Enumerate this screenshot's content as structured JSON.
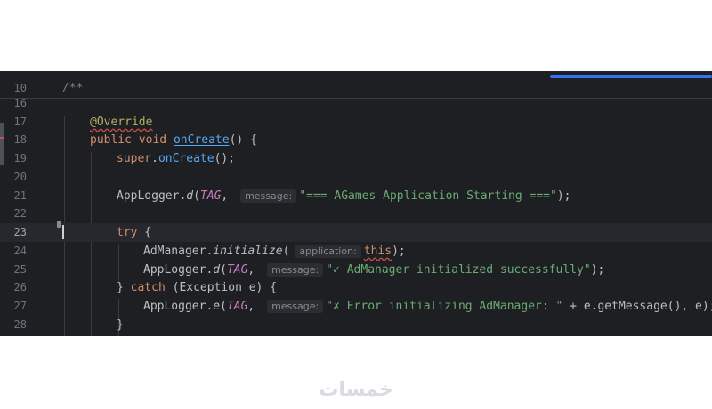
{
  "colors": {
    "editor_background": "#1e1f22",
    "current_line": "#26282e",
    "keyword": "#cf8e6d",
    "annotation": "#b3ae60",
    "method": "#56a8f5",
    "string": "#6aab73",
    "constant": "#c77dbb",
    "comment": "#7a7e85",
    "progress": "#3574f0",
    "error_underline": "#c94f4f"
  },
  "progress": {
    "fraction": 1.0
  },
  "editor": {
    "current_line": "23",
    "lines": [
      {
        "num": "10",
        "comment": "/**"
      },
      {
        "num": "16"
      },
      {
        "num": "17",
        "annotation": "@Override"
      },
      {
        "num": "18",
        "kw1": "public",
        "kw2": "void",
        "method": "onCreate",
        "rest": "() {"
      },
      {
        "num": "19",
        "kw": "super",
        "dot": ".",
        "method": "onCreate",
        "rest": "();"
      },
      {
        "num": "20"
      },
      {
        "num": "21",
        "cls": "AppLogger.",
        "method": "d",
        "open": "(",
        "const": "TAG",
        "comma": ", ",
        "hint": "message:",
        "str": "\"=== AGames Application Starting ===\"",
        "rest": ");"
      },
      {
        "num": "22"
      },
      {
        "num": "23",
        "kw": "try",
        "rest": " {"
      },
      {
        "num": "24",
        "cls": "AdManager.",
        "method": "initialize",
        "open": "(",
        "hint": "application:",
        "kw": "this",
        "rest": ");"
      },
      {
        "num": "25",
        "cls": "AppLogger.",
        "method": "d",
        "open": "(",
        "const": "TAG",
        "comma": ", ",
        "hint": "message:",
        "str": "\"✓ AdManager initialized successfully\"",
        "rest": ");"
      },
      {
        "num": "26",
        "pre": "} ",
        "kw": "catch",
        "rest": " (Exception e) {"
      },
      {
        "num": "27",
        "cls": "AppLogger.",
        "method": "e",
        "open": "(",
        "const": "TAG",
        "comma": ", ",
        "hint": "message:",
        "str": "\"✗ Error initializing AdManager: \"",
        "rest": " + e.getMessage(), e);"
      },
      {
        "num": "28",
        "rest": "}"
      }
    ]
  },
  "watermark": {
    "text": "خمسات"
  }
}
